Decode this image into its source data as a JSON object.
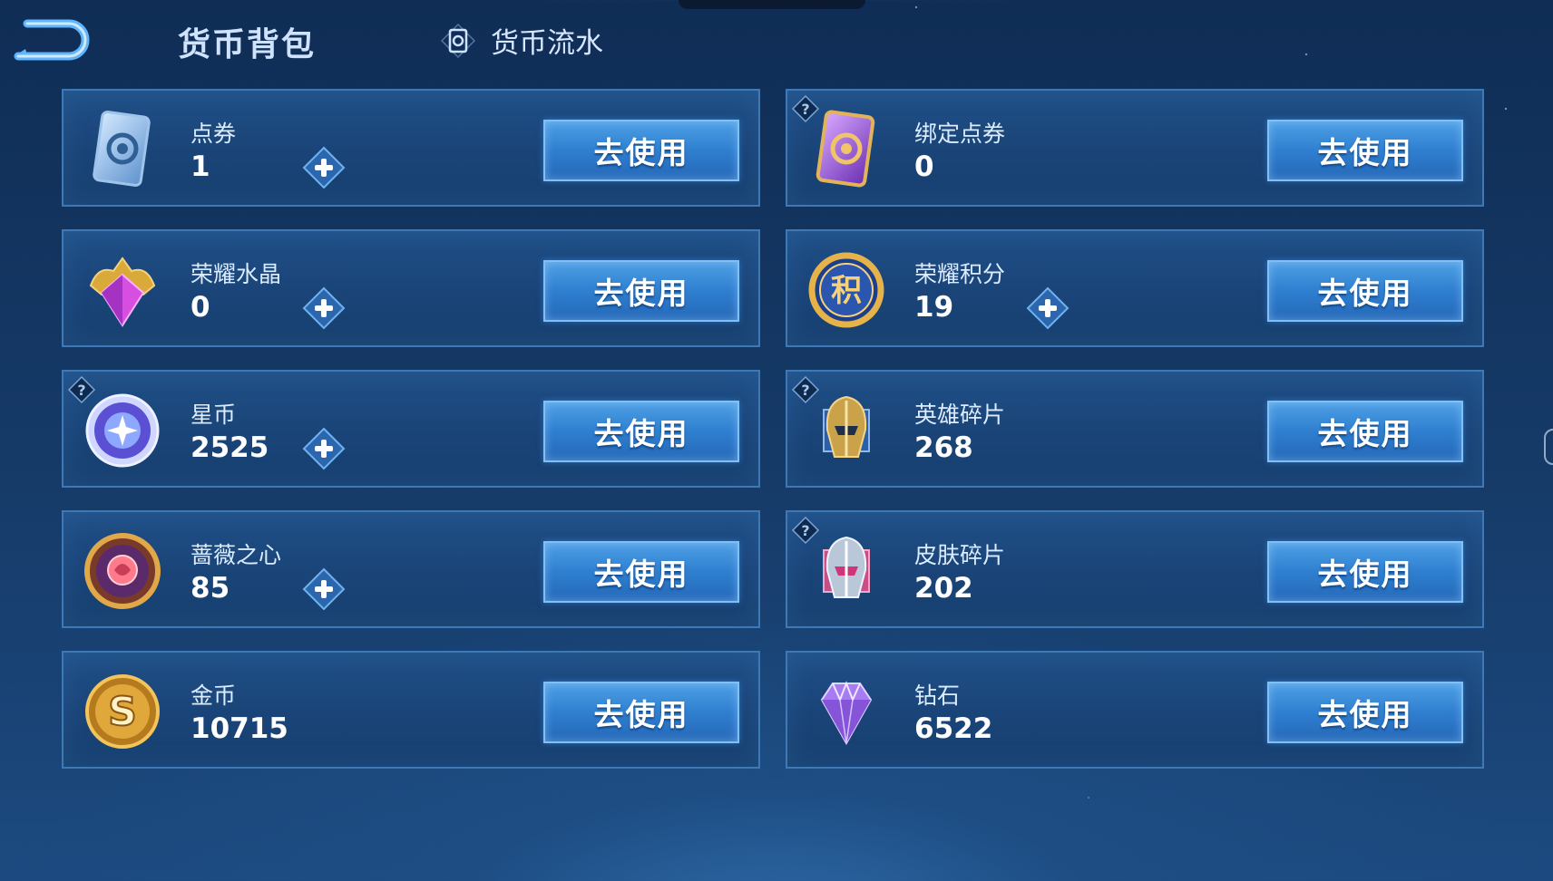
{
  "header": {
    "title": "货币背包",
    "flow_link_label": "货币流水"
  },
  "use_label": "去使用",
  "currencies": [
    {
      "name": "点券",
      "count": "1",
      "icon": "blue-ticket-icon",
      "has_plus": true,
      "has_help": false
    },
    {
      "name": "绑定点券",
      "count": "0",
      "icon": "purple-ticket-icon",
      "has_plus": false,
      "has_help": true
    },
    {
      "name": "荣耀水晶",
      "count": "0",
      "icon": "glory-crystal-icon",
      "has_plus": true,
      "has_help": false
    },
    {
      "name": "荣耀积分",
      "count": "19",
      "icon": "glory-points-icon",
      "has_plus": true,
      "has_help": false
    },
    {
      "name": "星币",
      "count": "2525",
      "icon": "star-coin-icon",
      "has_plus": true,
      "has_help": true
    },
    {
      "name": "英雄碎片",
      "count": "268",
      "icon": "hero-fragment-icon",
      "has_plus": false,
      "has_help": true
    },
    {
      "name": "蔷薇之心",
      "count": "85",
      "icon": "rose-heart-icon",
      "has_plus": true,
      "has_help": false
    },
    {
      "name": "皮肤碎片",
      "count": "202",
      "icon": "skin-fragment-icon",
      "has_plus": false,
      "has_help": true
    },
    {
      "name": "金币",
      "count": "10715",
      "icon": "gold-coin-icon",
      "has_plus": false,
      "has_help": false
    },
    {
      "name": "钻石",
      "count": "6522",
      "icon": "diamond-icon",
      "has_plus": false,
      "has_help": false
    }
  ],
  "icon_text": {
    "glory_points": "积",
    "gold_coin": "S",
    "help": "?"
  },
  "colors": {
    "card_border": "#3f79b5",
    "button": "#2f7fd0",
    "gold": "#d9a93a",
    "purple": "#9a5bd6"
  }
}
